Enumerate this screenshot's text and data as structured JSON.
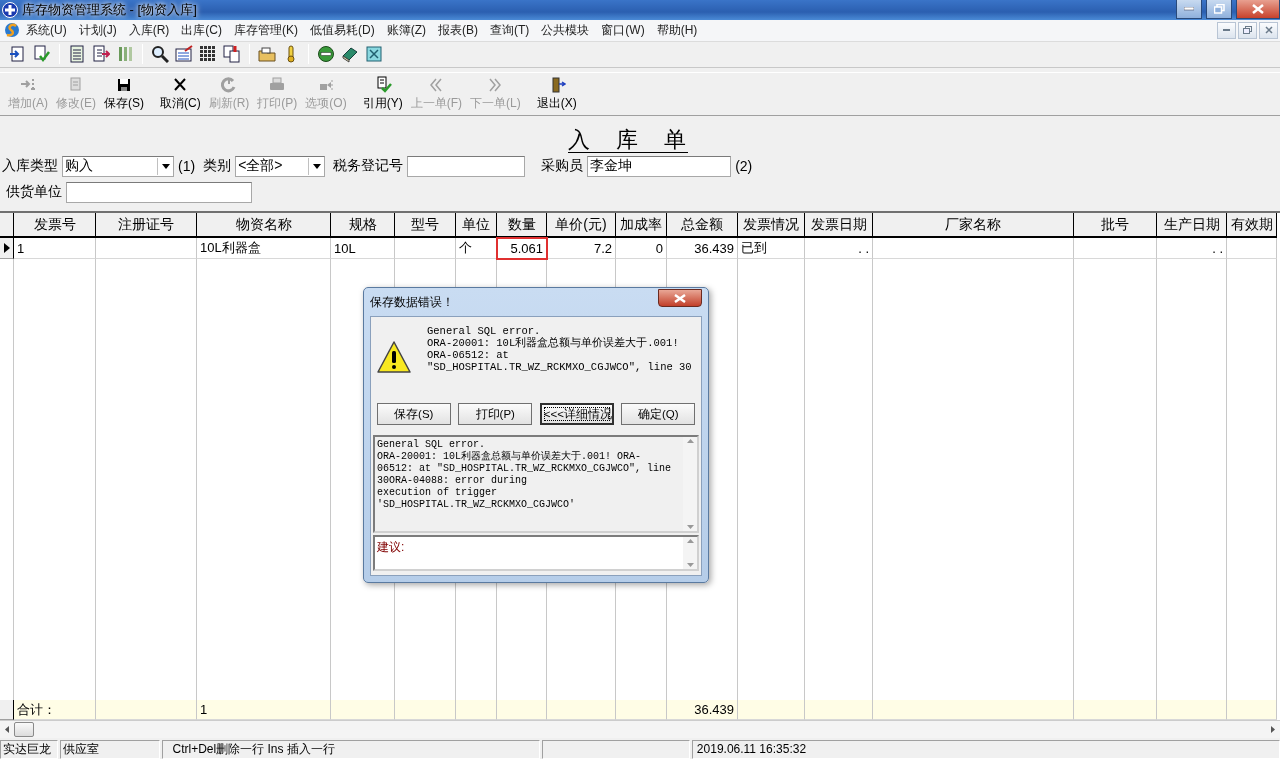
{
  "window": {
    "title": "库存物资管理系统 - [物资入库]"
  },
  "menu": [
    "系统(U)",
    "计划(J)",
    "入库(R)",
    "出库(C)",
    "库存管理(K)",
    "低值易耗(D)",
    "账簿(Z)",
    "报表(B)",
    "查询(T)",
    "公共模块",
    "窗口(W)",
    "帮助(H)"
  ],
  "actions": [
    {
      "label": "增加(A)",
      "disabled": true
    },
    {
      "label": "修改(E)",
      "disabled": true
    },
    {
      "label": "保存(S)",
      "disabled": false
    },
    {
      "label": "取消(C)",
      "disabled": false
    },
    {
      "label": "刷新(R)",
      "disabled": true
    },
    {
      "label": "打印(P)",
      "disabled": true
    },
    {
      "label": "选项(O)",
      "disabled": true
    },
    {
      "label": "引用(Y)",
      "disabled": false
    },
    {
      "label": "上一单(F)",
      "disabled": true
    },
    {
      "label": "下一单(L)",
      "disabled": true
    },
    {
      "label": "退出(X)",
      "disabled": false
    }
  ],
  "document_title": "入　库　单",
  "form": {
    "row_1": [
      {
        "kind": "select",
        "label": "入库类型",
        "value": "购入"
      },
      {
        "kind": "note",
        "label": "(1)"
      },
      {
        "kind": "select",
        "label": "类别",
        "value": "<全部>"
      },
      {
        "kind": "input",
        "label": "税务登记号"
      },
      {
        "kind": "input",
        "label": "采购员",
        "value": "李金坤"
      },
      {
        "kind": "note",
        "label": "(2)"
      }
    ],
    "row_2": [
      {
        "kind": "input",
        "label": "供货单位"
      }
    ]
  },
  "table": {
    "columns": [
      "发票号",
      "注册证号",
      "物资名称",
      "规格",
      "型号",
      "单位",
      "数量",
      "单价(元)",
      "加成率",
      "总金额",
      "发票情况",
      "发票日期",
      "厂家名称",
      "批号",
      "生产日期",
      "有效期"
    ],
    "rows": [
      {
        "selected": true,
        "cells": [
          {
            "text": "1"
          },
          {},
          {
            "text": "10L利器盒"
          },
          {
            "text": "10L"
          },
          {},
          {
            "text": "个"
          },
          {
            "text": "5.061",
            "outlined": true
          },
          {
            "text": "7.2"
          },
          {
            "text": "0"
          },
          {
            "text": "36.439"
          },
          {
            "text": "已到"
          },
          {
            "text": ".  ."
          },
          {},
          {},
          {
            "text": ".  ."
          },
          {}
        ]
      }
    ],
    "totals": {
      "label": "合计：",
      "cells": [
        {},
        {},
        {
          "text": "1"
        },
        {},
        {},
        {},
        {},
        {},
        {},
        {
          "text": "36.439"
        },
        {},
        {},
        {},
        {},
        {},
        {}
      ]
    }
  },
  "dialog": {
    "title": "保存数据错误！",
    "message": [
      "General SQL error.",
      "ORA-20001: 10L利器盒总额与单价误差大于.001!",
      "ORA-06512: at",
      "\"SD_HOSPITAL.TR_WZ_RCKMXO_CGJWCO\", line 30"
    ],
    "buttons": [
      {
        "label": "保存(S)",
        "selected": false
      },
      {
        "label": "打印(P)",
        "selected": false
      },
      {
        "label": "<<<详细情况",
        "selected": true
      },
      {
        "label": "确定(Q)",
        "selected": false
      }
    ],
    "details": [
      "General SQL error.",
      "ORA-20001: 10L利器盒总额与单价误差大于.001! ORA-",
      "06512: at \"SD_HOSPITAL.TR_WZ_RCKMXO_CGJWCO\", line",
      "30ORA-04088: error during",
      "execution of trigger",
      "'SD_HOSPITAL.TR_WZ_RCKMXO_CGJWCO'"
    ],
    "suggestion_label": "建议:"
  },
  "status_bar": [
    "实达巨龙",
    "供应室",
    "Ctrl+Del删除一行   Ins 插入一行",
    "2019.06.11 16:35:32"
  ]
}
